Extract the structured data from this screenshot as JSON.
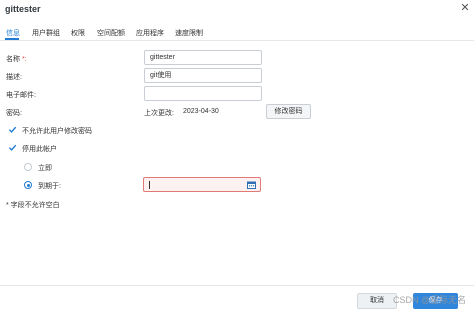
{
  "window": {
    "title": "gittester"
  },
  "tabs": [
    "信息",
    "用户群组",
    "权限",
    "空间配额",
    "应用程序",
    "速度限制"
  ],
  "form": {
    "name_label": "名称",
    "name_required": "*:",
    "name_value": "gittester",
    "desc_label": "描述:",
    "desc_value": "git使用",
    "email_label": "电子邮件:",
    "email_value": "",
    "password_label": "密码:",
    "password_last_changed": "上次更改:",
    "password_date": "2023-04-30",
    "change_password_button": "修改密码",
    "disallow_change_label": "不允许此用户修改密码",
    "disable_account_label": "停用此帐户",
    "immediately_label": "立即",
    "expire_on_label": "到期于:",
    "expire_value": "",
    "required_note": "* 字段不允许空白"
  },
  "footer": {
    "cancel_label": "取消",
    "save_label": "保存",
    "watermark": "CSDN @星际无名"
  },
  "colors": {
    "accent": "#1f7bd4",
    "error_border": "#e07a75",
    "error_bg": "#fdf1f1"
  }
}
